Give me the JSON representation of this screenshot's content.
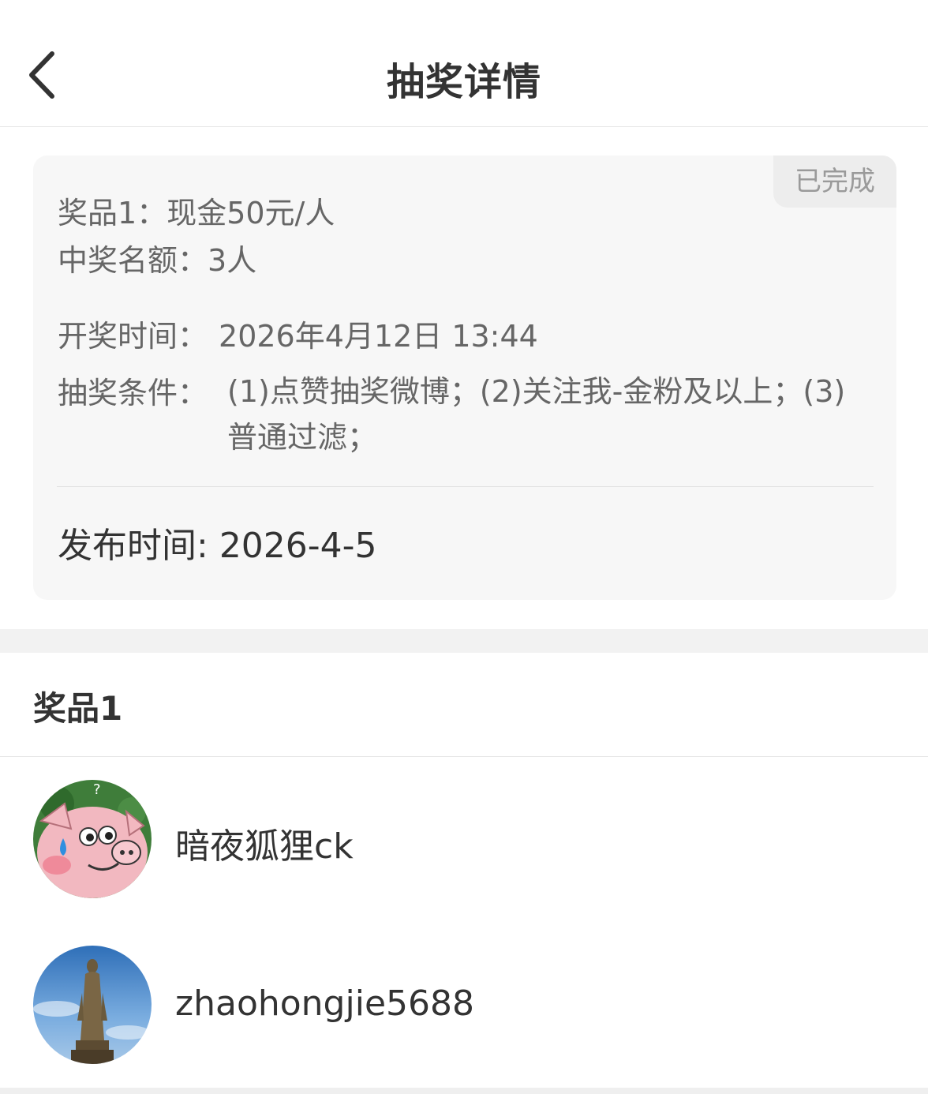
{
  "header": {
    "title": "抽奖详情"
  },
  "card": {
    "status": "已完成",
    "prize_label": "奖品1：",
    "prize_value": "现金50元/人",
    "winners_label": "中奖名额：",
    "winners_value": "3人",
    "draw_time_label": "开奖时间：",
    "draw_time_value": "2026年4月12日 13:44",
    "conditions_label": "抽奖条件：",
    "conditions_value": "(1)点赞抽奖微博；(2)关注我-金粉及以上；(3)普通过滤；",
    "publish_label": "发布时间: ",
    "publish_value": "2026-4-5"
  },
  "prize_section": {
    "title": "奖品1",
    "winners": [
      {
        "name": "暗夜狐狸ck",
        "avatar": "cartoon-pig-avatar"
      },
      {
        "name": "zhaohongjie5688",
        "avatar": "statue-sky-avatar"
      }
    ]
  },
  "icons": {
    "back": "chevron-left-icon"
  },
  "colors": {
    "card_bg": "#f7f7f7",
    "badge_bg": "#ededed",
    "badge_text": "#9a9a9a",
    "primary_text": "#333333",
    "secondary_text": "#666666"
  }
}
